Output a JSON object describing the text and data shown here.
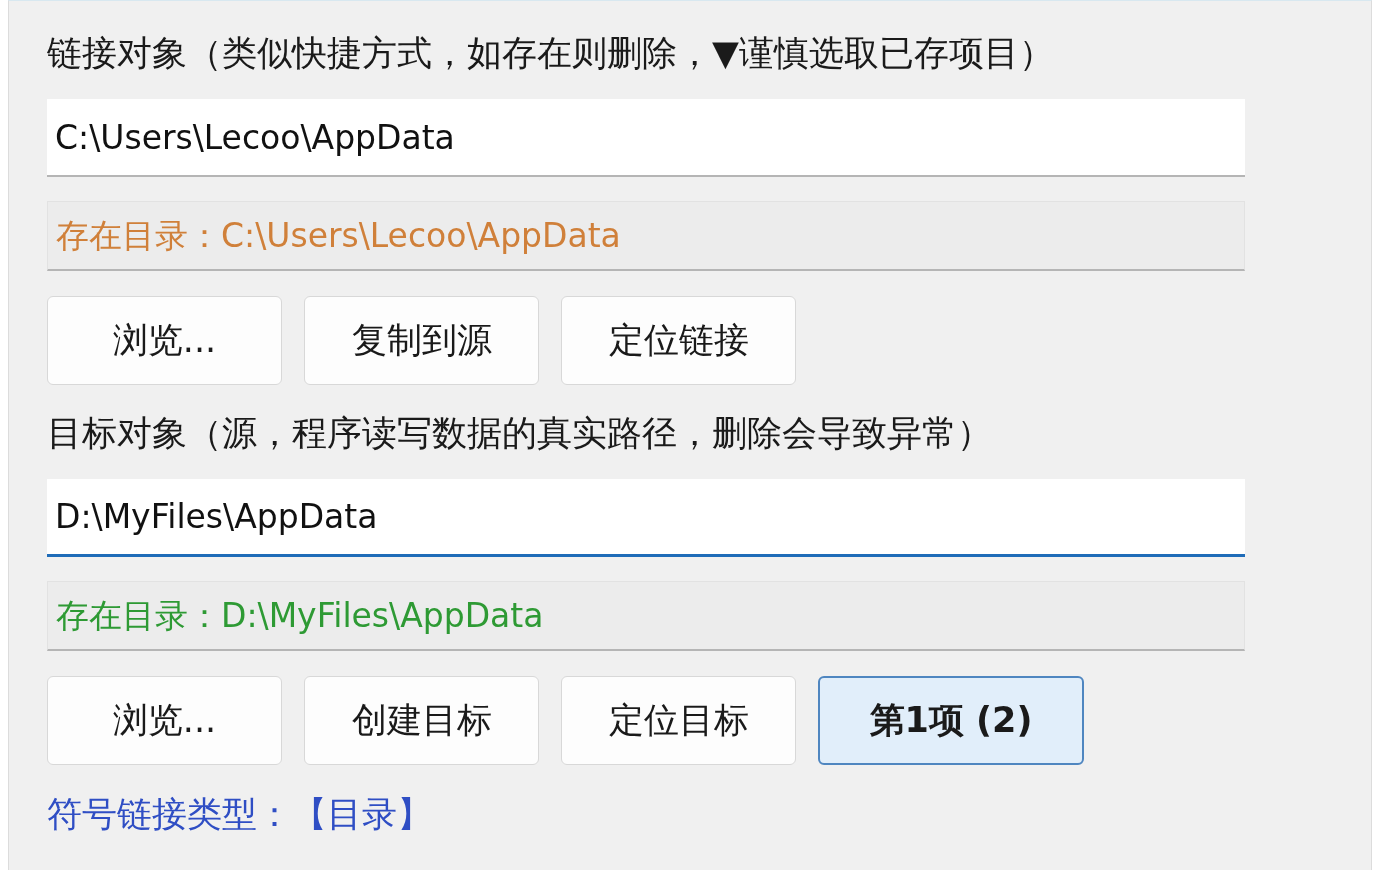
{
  "sections": [
    {
      "label": "链接对象（类似快捷方式，如存在则删除，▼谨慎选取已存项目）",
      "path": {
        "value": "C:\\Users\\Lecoo\\AppData",
        "focused": false
      },
      "status": {
        "text": "存在目录：C:\\Users\\Lecoo\\AppData",
        "color": "#d0803a"
      },
      "buttons": [
        {
          "label": "浏览...",
          "highlighted": false
        },
        {
          "label": "复制到源",
          "highlighted": false
        },
        {
          "label": "定位链接",
          "highlighted": false
        }
      ]
    },
    {
      "label": "目标对象（源，程序读写数据的真实路径，删除会导致异常）",
      "path": {
        "value": "D:\\MyFiles\\AppData",
        "focused": true
      },
      "status": {
        "text": "存在目录：D:\\MyFiles\\AppData",
        "color": "#2e9a34"
      },
      "buttons": [
        {
          "label": "浏览...",
          "highlighted": false
        },
        {
          "label": "创建目标",
          "highlighted": false
        },
        {
          "label": "定位目标",
          "highlighted": false
        },
        {
          "label": "第1项 (2)",
          "highlighted": true
        }
      ]
    }
  ],
  "link_type": "符号链接类型：【目录】"
}
